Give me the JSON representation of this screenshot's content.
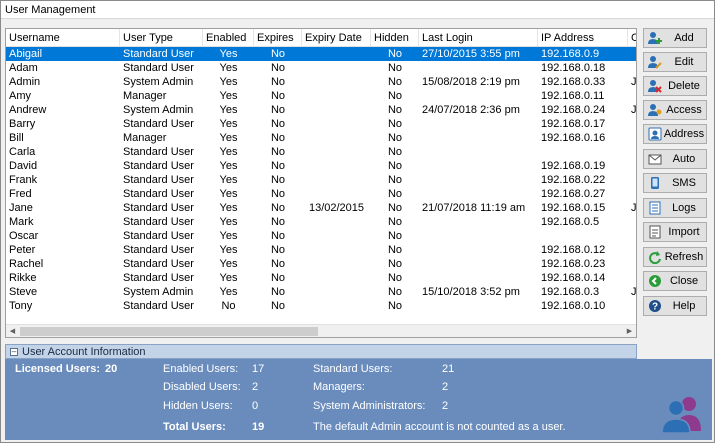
{
  "window": {
    "title": "User Management"
  },
  "table": {
    "columns": [
      "Username",
      "User Type",
      "Enabled",
      "Expires",
      "Expiry Date",
      "Hidden",
      "Last Login",
      "IP Address",
      "C"
    ],
    "rows": [
      [
        "Abigail",
        "Standard User",
        "Yes",
        "No",
        "",
        "No",
        "27/10/2015 3:55 pm",
        "192.168.0.9",
        ""
      ],
      [
        "Adam",
        "Standard User",
        "Yes",
        "No",
        "",
        "No",
        "",
        "192.168.0.18",
        ""
      ],
      [
        "Admin",
        "System Admin",
        "Yes",
        "No",
        "",
        "No",
        "15/08/2018 2:19 pm",
        "192.168.0.33",
        "JU"
      ],
      [
        "Amy",
        "Manager",
        "Yes",
        "No",
        "",
        "No",
        "",
        "192.168.0.11",
        ""
      ],
      [
        "Andrew",
        "System Admin",
        "Yes",
        "No",
        "",
        "No",
        "24/07/2018 2:36 pm",
        "192.168.0.24",
        "JU"
      ],
      [
        "Barry",
        "Standard User",
        "Yes",
        "No",
        "",
        "No",
        "",
        "192.168.0.17",
        ""
      ],
      [
        "Bill",
        "Manager",
        "Yes",
        "No",
        "",
        "No",
        "",
        "192.168.0.16",
        ""
      ],
      [
        "Carla",
        "Standard User",
        "Yes",
        "No",
        "",
        "No",
        "",
        "",
        ""
      ],
      [
        "David",
        "Standard User",
        "Yes",
        "No",
        "",
        "No",
        "",
        "192.168.0.19",
        ""
      ],
      [
        "Frank",
        "Standard User",
        "Yes",
        "No",
        "",
        "No",
        "",
        "192.168.0.22",
        ""
      ],
      [
        "Fred",
        "Standard User",
        "Yes",
        "No",
        "",
        "No",
        "",
        "192.168.0.27",
        ""
      ],
      [
        "Jane",
        "Standard User",
        "Yes",
        "No",
        "13/02/2015",
        "No",
        "21/07/2018 11:19 am",
        "192.168.0.15",
        "JU"
      ],
      [
        "Mark",
        "Standard User",
        "Yes",
        "No",
        "",
        "No",
        "",
        "192.168.0.5",
        ""
      ],
      [
        "Oscar",
        "Standard User",
        "Yes",
        "No",
        "",
        "No",
        "",
        "",
        ""
      ],
      [
        "Peter",
        "Standard User",
        "Yes",
        "No",
        "",
        "No",
        "",
        "192.168.0.12",
        ""
      ],
      [
        "Rachel",
        "Standard User",
        "Yes",
        "No",
        "",
        "No",
        "",
        "192.168.0.23",
        ""
      ],
      [
        "Rikke",
        "Standard User",
        "Yes",
        "No",
        "",
        "No",
        "",
        "192.168.0.14",
        ""
      ],
      [
        "Steve",
        "System Admin",
        "Yes",
        "No",
        "",
        "No",
        "15/10/2018 3:52 pm",
        "192.168.0.3",
        "JU"
      ],
      [
        "Tony",
        "Standard User",
        "No",
        "No",
        "",
        "No",
        "",
        "192.168.0.10",
        ""
      ]
    ],
    "selected_row": 0
  },
  "buttons": [
    {
      "label": "Add",
      "icon": "add-user-icon"
    },
    {
      "label": "Edit",
      "icon": "edit-user-icon"
    },
    {
      "label": "Delete",
      "icon": "delete-user-icon"
    },
    {
      "label": "Access",
      "icon": "access-icon"
    },
    {
      "label": "Address",
      "icon": "address-icon"
    },
    {
      "label": "Auto",
      "icon": "envelope-icon"
    },
    {
      "label": "SMS",
      "icon": "phone-icon"
    },
    {
      "label": "Logs",
      "icon": "logs-icon"
    },
    {
      "label": "Import",
      "icon": "import-icon"
    },
    {
      "label": "Refresh",
      "icon": "refresh-icon"
    },
    {
      "label": "Close",
      "icon": "close-icon"
    },
    {
      "label": "Help",
      "icon": "help-icon"
    }
  ],
  "info": {
    "section_title": "User Account Information",
    "licensed_label": "Licensed Users:",
    "licensed_value": "20",
    "enabled_label": "Enabled Users:",
    "enabled_value": "17",
    "disabled_label": "Disabled Users:",
    "disabled_value": "2",
    "hidden_label": "Hidden Users:",
    "hidden_value": "0",
    "total_label": "Total Users:",
    "total_value": "19",
    "standard_label": "Standard Users:",
    "standard_value": "21",
    "managers_label": "Managers:",
    "managers_value": "2",
    "sysadmin_label": "System Administrators:",
    "sysadmin_value": "2",
    "note": "The default Admin account is not counted as a user."
  },
  "colors": {
    "selection": "#0078d7",
    "info_panel": "#6a8cbd",
    "info_header": "#c3d3e8"
  }
}
